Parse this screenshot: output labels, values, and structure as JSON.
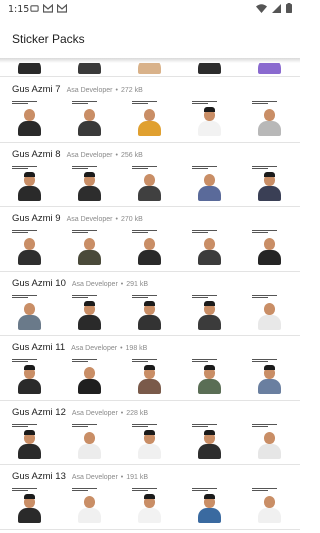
{
  "status_bar": {
    "time": "1:15",
    "left_icons": [
      "android-system-icon",
      "gmail-icon",
      "gmail-icon"
    ],
    "right_icons": [
      "wifi-icon",
      "signal-icon",
      "battery-icon"
    ]
  },
  "app_bar": {
    "title": "Sticker Packs"
  },
  "colors": {
    "divider": "#e3e3e3",
    "meta_text": "#8a8a8a",
    "title_text": "#212121"
  },
  "packs": [
    {
      "name": "Gus Azmi 7",
      "author": "Asa Developer",
      "separator": "•",
      "size": "272 kB",
      "stickers": [
        {
          "shirt": "#2a2a2a",
          "hat": false,
          "caption": true
        },
        {
          "shirt": "#3a3a3a",
          "hat": false,
          "caption": true
        },
        {
          "shirt": "#e0a030",
          "hat": false,
          "caption": true
        },
        {
          "shirt": "#f2f2f2",
          "hat": true,
          "caption": true
        },
        {
          "shirt": "#b8b8b8",
          "hat": false,
          "caption": true
        }
      ]
    },
    {
      "name": "Gus Azmi 8",
      "author": "Asa Developer",
      "separator": "•",
      "size": "256 kB",
      "stickers": [
        {
          "shirt": "#2a2a2a",
          "hat": true,
          "caption": true
        },
        {
          "shirt": "#2d2d2d",
          "hat": true,
          "caption": true
        },
        {
          "shirt": "#404040",
          "hat": false,
          "caption": true
        },
        {
          "shirt": "#5a6a9a",
          "hat": false,
          "caption": true
        },
        {
          "shirt": "#3a3f55",
          "hat": true,
          "caption": true
        }
      ]
    },
    {
      "name": "Gus Azmi 9",
      "author": "Asa Developer",
      "separator": "•",
      "size": "270 kB",
      "stickers": [
        {
          "shirt": "#2f2f2f",
          "hat": false,
          "caption": true
        },
        {
          "shirt": "#4a4a3a",
          "hat": false,
          "caption": true
        },
        {
          "shirt": "#2a2a2a",
          "hat": false,
          "caption": true
        },
        {
          "shirt": "#3c3c3c",
          "hat": false,
          "caption": true
        },
        {
          "shirt": "#252525",
          "hat": false,
          "caption": true
        }
      ]
    },
    {
      "name": "Gus Azmi 10",
      "author": "Asa Developer",
      "separator": "•",
      "size": "291 kB",
      "stickers": [
        {
          "shirt": "#6a7a8a",
          "hat": false,
          "caption": true
        },
        {
          "shirt": "#2a2a2a",
          "hat": true,
          "caption": true
        },
        {
          "shirt": "#333333",
          "hat": true,
          "caption": true
        },
        {
          "shirt": "#3b3b3b",
          "hat": true,
          "caption": true
        },
        {
          "shirt": "#e8e8e8",
          "hat": false,
          "caption": true
        }
      ]
    },
    {
      "name": "Gus Azmi 11",
      "author": "Asa Developer",
      "separator": "•",
      "size": "198 kB",
      "stickers": [
        {
          "shirt": "#2a2a2a",
          "hat": true,
          "caption": true
        },
        {
          "shirt": "#1f1f1f",
          "hat": false,
          "caption": true
        },
        {
          "shirt": "#7a5a4a",
          "hat": true,
          "caption": true
        },
        {
          "shirt": "#5a6e55",
          "hat": true,
          "caption": true
        },
        {
          "shirt": "#6a7fa0",
          "hat": true,
          "caption": true
        }
      ]
    },
    {
      "name": "Gus Azmi 12",
      "author": "Asa Developer",
      "separator": "•",
      "size": "228 kB",
      "stickers": [
        {
          "shirt": "#2a2a2a",
          "hat": true,
          "caption": true
        },
        {
          "shirt": "#ececec",
          "hat": false,
          "caption": true
        },
        {
          "shirt": "#f0f0f0",
          "hat": true,
          "caption": true
        },
        {
          "shirt": "#2e2e2e",
          "hat": true,
          "caption": true
        },
        {
          "shirt": "#e6e6e6",
          "hat": false,
          "caption": true
        }
      ]
    },
    {
      "name": "Gus Azmi 13",
      "author": "Asa Developer",
      "separator": "•",
      "size": "191 kB",
      "stickers": [
        {
          "shirt": "#2a2a2a",
          "hat": true,
          "caption": true
        },
        {
          "shirt": "#f0f0f0",
          "hat": false,
          "caption": true
        },
        {
          "shirt": "#f2f2f2",
          "hat": true,
          "caption": true
        },
        {
          "shirt": "#3a6aa0",
          "hat": true,
          "caption": true
        },
        {
          "shirt": "#f0f0f0",
          "hat": false,
          "caption": true
        }
      ]
    }
  ]
}
